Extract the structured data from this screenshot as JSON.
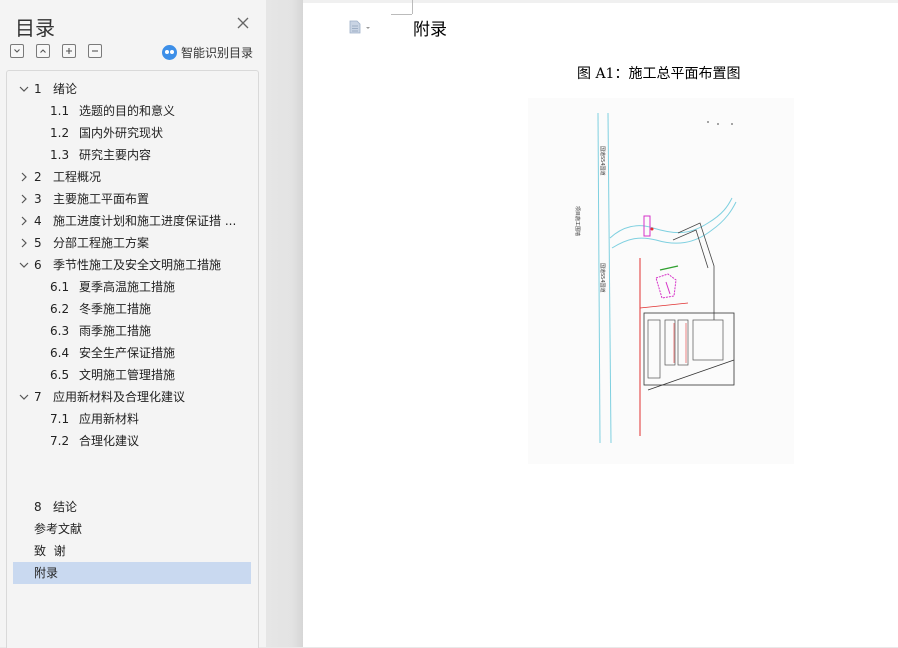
{
  "toc": {
    "title": "目录",
    "smart_label": "智能识别目录",
    "items": [
      {
        "num": "1",
        "label": "绪论",
        "level": 1,
        "expanded": true,
        "has_children": true
      },
      {
        "num": "1.1",
        "label": "选题的目的和意义",
        "level": 2
      },
      {
        "num": "1.2",
        "label": "国内外研究现状",
        "level": 2
      },
      {
        "num": "1.3",
        "label": "研究主要内容",
        "level": 2
      },
      {
        "num": "2",
        "label": "工程概况",
        "level": 1,
        "has_children": true,
        "expanded": false
      },
      {
        "num": "3",
        "label": "主要施工平面布置",
        "level": 1,
        "has_children": true,
        "expanded": false
      },
      {
        "num": "4",
        "label": "施工进度计划和施工进度保证措 ...",
        "level": 1,
        "has_children": true,
        "expanded": false
      },
      {
        "num": "5",
        "label": "分部工程施工方案",
        "level": 1,
        "has_children": true,
        "expanded": false
      },
      {
        "num": "6",
        "label": "季节性施工及安全文明施工措施",
        "level": 1,
        "has_children": true,
        "expanded": true
      },
      {
        "num": "6.1",
        "label": "夏季高温施工措施",
        "level": 2
      },
      {
        "num": "6.2",
        "label": "冬季施工措施",
        "level": 2
      },
      {
        "num": "6.3",
        "label": "雨季施工措施",
        "level": 2
      },
      {
        "num": "6.4",
        "label": "安全生产保证措施",
        "level": 2
      },
      {
        "num": "6.5",
        "label": "文明施工管理措施",
        "level": 2
      },
      {
        "num": "7",
        "label": "应用新材料及合理化建议",
        "level": 1,
        "has_children": true,
        "expanded": true
      },
      {
        "num": "7.1",
        "label": "应用新材料",
        "level": 2
      },
      {
        "num": "7.2",
        "label": "合理化建议",
        "level": 2
      }
    ],
    "tail_items": [
      {
        "num": "8",
        "label": "结论"
      },
      {
        "num": "",
        "label": "参考文献"
      },
      {
        "num": "",
        "label": "致  谢"
      },
      {
        "num": "",
        "label": "附录",
        "selected": true
      }
    ]
  },
  "document": {
    "heading": "附录",
    "caption": "图 A1：施工总平面布置图",
    "drawing_labels": [
      "国道S54国道",
      "项目施工围墙",
      "国道S54国道"
    ]
  },
  "colors": {
    "selection": "#c9d9f0",
    "accent_blue": "#3d8fe8",
    "drawing_magenta": "#d632c8",
    "drawing_red": "#e03030",
    "drawing_cyan": "#7fd0e0",
    "drawing_green": "#30a030"
  }
}
